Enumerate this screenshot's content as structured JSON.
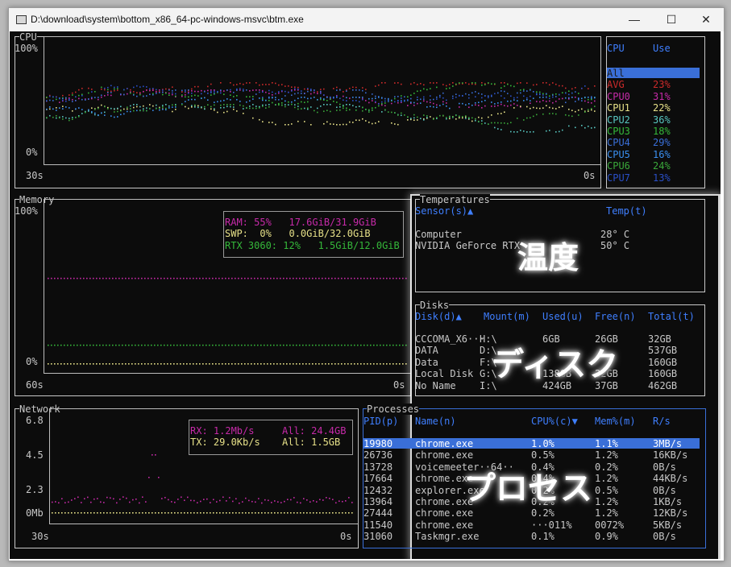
{
  "window": {
    "title": "D:\\download\\system\\bottom_x86_64-pc-windows-msvc\\btm.exe",
    "minimize": "—",
    "maximize": "☐",
    "close": "✕"
  },
  "cpu": {
    "title": "CPU",
    "y_top": "100%",
    "y_bottom": "0%",
    "x_left": "30s",
    "x_right": "0s",
    "legend_head": {
      "cpu": "CPU",
      "use": "Use"
    },
    "legend": [
      {
        "name": "All",
        "use": "",
        "color": "#1b1b1b"
      },
      {
        "name": "AVG",
        "use": "23%",
        "color": "#cc2a2a"
      },
      {
        "name": "CPU0",
        "use": "31%",
        "color": "#c62aa8"
      },
      {
        "name": "CPU1",
        "use": "22%",
        "color": "#e6e088"
      },
      {
        "name": "CPU2",
        "use": "36%",
        "color": "#58c6c0"
      },
      {
        "name": "CPU3",
        "use": "18%",
        "color": "#35b83a"
      },
      {
        "name": "CPU4",
        "use": "29%",
        "color": "#3a6fd8"
      },
      {
        "name": "CPU5",
        "use": "16%",
        "color": "#3a8ff0"
      },
      {
        "name": "CPU6",
        "use": "24%",
        "color": "#3aa83a"
      },
      {
        "name": "CPU7",
        "use": "13%",
        "color": "#2a4fc8"
      }
    ]
  },
  "memory": {
    "title": "Memory",
    "y_top": "100%",
    "y_bottom": "0%",
    "x_left": "60s",
    "x_right": "0s",
    "ram": "RAM: 55%   17.6GiB/31.9GiB",
    "swp": "SWP:  0%   0.0GiB/32.0GiB",
    "gpu": "RTX 3060: 12%   1.5GiB/12.0GiB",
    "ram_color": "#c62aa8",
    "swp_color": "#e6e088",
    "gpu_color": "#35b83a",
    "ram_level": 0.55,
    "gpu_level": 0.12,
    "swp_level": 0.0
  },
  "temperatures": {
    "title": "Temperatures",
    "col_sensor": "Sensor(s)▲",
    "col_temp": "Temp(t)",
    "rows": [
      {
        "sensor": "Computer",
        "temp": "28° C"
      },
      {
        "sensor": "NVIDIA GeForce RTX",
        "temp": "50° C"
      }
    ],
    "overlay": "温度"
  },
  "disks": {
    "title": "Disks",
    "cols": [
      "Disk(d)▲",
      "Mount(m)",
      "Used(u)",
      "Free(n)",
      "Total(t)"
    ],
    "rows": [
      [
        "CCCOMA_X6···",
        "H:\\",
        "6GB",
        "26GB",
        "32GB"
      ],
      [
        "DATA",
        "D:\\",
        "",
        "",
        "537GB"
      ],
      [
        "Data",
        "F:\\",
        "",
        "",
        "160GB"
      ],
      [
        "Local Disk",
        "G:\\",
        "138GB",
        "22GB",
        "160GB"
      ],
      [
        "No Name",
        "I:\\",
        "424GB",
        "37GB",
        "462GB"
      ]
    ],
    "overlay": "ディスク"
  },
  "network": {
    "title": "Network",
    "y_labels": [
      "6.8",
      "4.5",
      "2.3",
      "0Mb"
    ],
    "x_left": "30s",
    "x_right": "0s",
    "rx": "RX: 1.2Mb/s",
    "rx_all": "All: 24.4GB",
    "tx": "TX: 29.0Kb/s",
    "tx_all": "All: 1.5GB",
    "rx_color": "#c62aa8",
    "tx_color": "#e6e088"
  },
  "processes": {
    "title": "Processes",
    "cols": [
      "PID(p)",
      "Name(n)",
      "CPU%(c)▼",
      "Mem%(m)",
      "R/s"
    ],
    "rows": [
      [
        "19980",
        "chrome.exe",
        "1.0%",
        "1.1%",
        "3MB/s"
      ],
      [
        "26736",
        "chrome.exe",
        "0.5%",
        "1.2%",
        "16KB/s"
      ],
      [
        "13728",
        "voicemeeter··64··",
        "0.4%",
        "0.2%",
        "0B/s"
      ],
      [
        "17664",
        "chrome.exe",
        "0.4%",
        "1.2%",
        "44KB/s"
      ],
      [
        "12432",
        "explorer.exe",
        "0.2%",
        "0.5%",
        "0B/s"
      ],
      [
        "13964",
        "chrome.exe",
        "0.2%",
        "1.2%",
        "1KB/s"
      ],
      [
        "27444",
        "chrome.exe",
        "0.2%",
        "1.2%",
        "12KB/s"
      ],
      [
        "11540",
        "chrome.exe",
        "···011%",
        "0072%",
        "5KB/s"
      ],
      [
        "31060",
        "Taskmgr.exe",
        "0.1%",
        "0.9%",
        "0B/s"
      ]
    ],
    "overlay": "プロセス"
  }
}
